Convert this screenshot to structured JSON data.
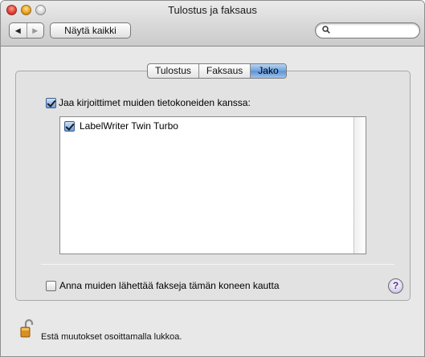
{
  "window": {
    "title": "Tulostus ja faksaus"
  },
  "toolbar": {
    "back_icon": "◀",
    "forward_icon": "▶",
    "show_all_label": "Näytä kaikki",
    "search_value": "",
    "search_placeholder": ""
  },
  "tabs": [
    {
      "label": "Tulostus",
      "selected": false
    },
    {
      "label": "Faksaus",
      "selected": false
    },
    {
      "label": "Jako",
      "selected": true
    }
  ],
  "sharing": {
    "share_printers_label": "Jaa kirjoittimet muiden tietokoneiden kanssa:",
    "share_printers_checked": true,
    "printers": [
      {
        "name": "LabelWriter Twin Turbo",
        "checked": true
      }
    ],
    "fax_label": "Anna muiden lähettää fakseja tämän koneen kautta",
    "fax_checked": false,
    "help_label": "?"
  },
  "footer": {
    "lock_label": "Estä muutokset osoittamalla lukkoa."
  },
  "colors": {
    "selected_tab": "#6ea2df",
    "window_background": "#e8e8e8"
  }
}
